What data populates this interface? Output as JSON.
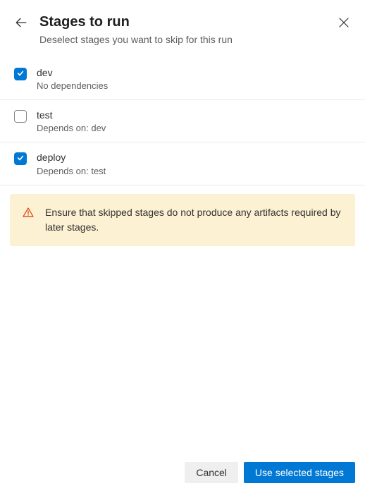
{
  "header": {
    "title": "Stages to run",
    "subtitle": "Deselect stages you want to skip for this run"
  },
  "stages": [
    {
      "name": "dev",
      "dependency": "No dependencies",
      "checked": true
    },
    {
      "name": "test",
      "dependency": "Depends on: dev",
      "checked": false
    },
    {
      "name": "deploy",
      "dependency": "Depends on: test",
      "checked": true
    }
  ],
  "warning": {
    "text": "Ensure that skipped stages do not produce any artifacts required by later stages."
  },
  "footer": {
    "cancel": "Cancel",
    "primary": "Use selected stages"
  },
  "colors": {
    "primary": "#0078d4",
    "warningBg": "#fdf1d3",
    "warningIcon": "#d83b01"
  }
}
